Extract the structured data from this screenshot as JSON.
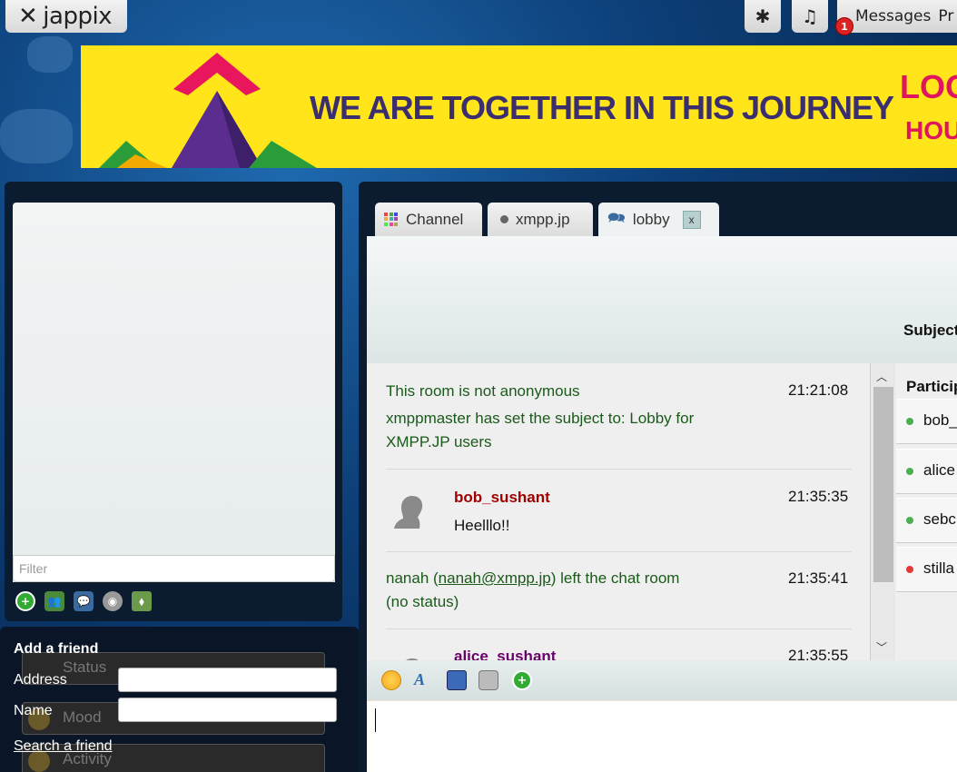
{
  "app": {
    "logo_text": "jappix"
  },
  "topbar": {
    "settings_icon": "asterisk-icon",
    "music_icon": "music-note-icon",
    "messages_label": "Messages",
    "profile_label_partial": "Pr",
    "messages_badge": "1"
  },
  "banner": {
    "text": "WE ARE TOGETHER IN THIS JOURNEY",
    "text_right_1": "LOO",
    "text_right_2": "HOU"
  },
  "roster": {
    "filter_placeholder": "Filter"
  },
  "add_friend": {
    "title": "Add a friend",
    "address_label": "Address",
    "name_label": "Name",
    "search_link": "Search a friend",
    "behind_status": "Status",
    "behind_mood": "Mood",
    "behind_activity": "Activity"
  },
  "tabs": [
    {
      "label": "Channel"
    },
    {
      "label": "xmpp.jp"
    },
    {
      "label": "lobby",
      "close": "x"
    }
  ],
  "chat": {
    "subject_label": "Subject",
    "messages": [
      {
        "text": "This room is not anonymous",
        "time": "21:21:08"
      },
      {
        "text": "xmppmaster has set the subject to: Lobby for",
        "text2": "XMPP.JP users"
      },
      {
        "nick": "bob_sushant",
        "text": "Heelllo!!",
        "time": "21:35:35"
      },
      {
        "text_pre": "nanah (",
        "link": "nanah@xmpp.jp",
        "text_post": ") left the chat room",
        "text2": "(no status)",
        "time": "21:35:41"
      },
      {
        "nick": "alice_sushant",
        "time": "21:35:55"
      }
    ]
  },
  "participants": {
    "header": "Particip",
    "list": [
      {
        "name": "bob_",
        "status_color": "#4caf50"
      },
      {
        "name": "alice",
        "status_color": "#4caf50"
      },
      {
        "name": "sebc",
        "status_color": "#4caf50"
      },
      {
        "name": "stilla",
        "status_color": "#e53935"
      }
    ]
  },
  "colors": {
    "nick_bob": "#a00000",
    "nick_alice": "#6a006a",
    "system_text": "#1a5a1a"
  }
}
